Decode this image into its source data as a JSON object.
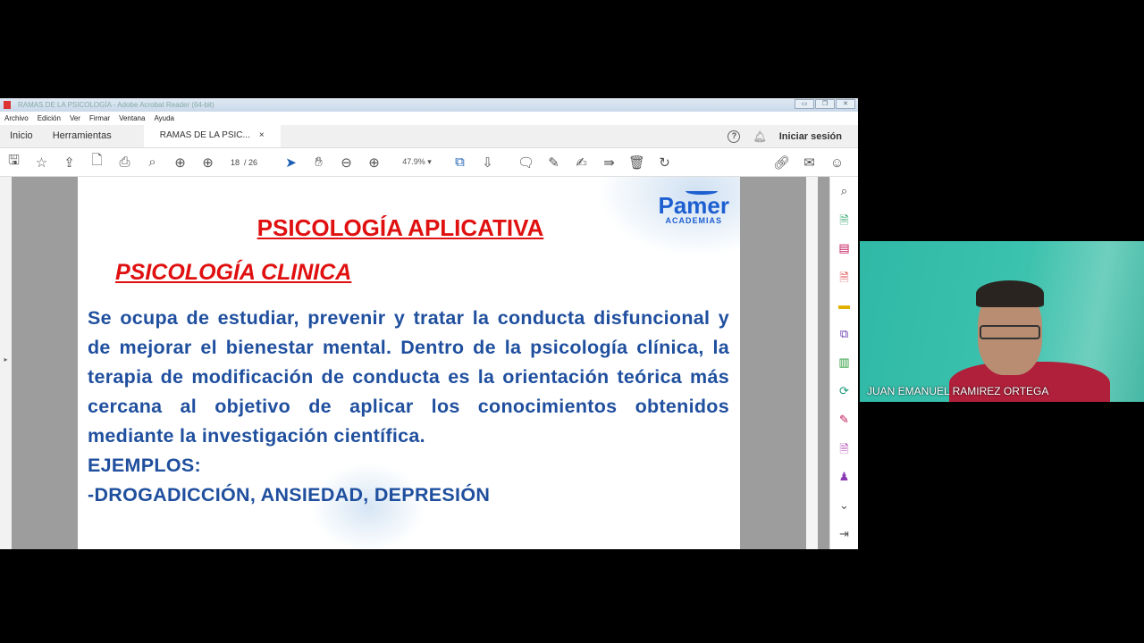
{
  "window": {
    "title": "RAMAS DE LA PSICOLOGÍA - Adobe Acrobat Reader (64-bit)",
    "controls": [
      "▭",
      "❐",
      "✕"
    ]
  },
  "menu": [
    "Archivo",
    "Edición",
    "Ver",
    "Firmar",
    "Ventana",
    "Ayuda"
  ],
  "tabs": {
    "home": "Inicio",
    "tools": "Herramientas",
    "doc": "RAMAS DE LA PSIC...",
    "close": "×",
    "help": "?",
    "signin": "Iniciar sesión"
  },
  "toolbar": {
    "page_current": "18",
    "page_total": "/ 26",
    "zoom": "47.9%"
  },
  "slide": {
    "logo_name": "Pamer",
    "logo_sub": "ACADEMIAS",
    "title": "PSICOLOGÍA APLICATIVA",
    "subtitle": "PSICOLOGÍA CLINICA",
    "paragraph": "Se ocupa de estudiar, prevenir y tratar la conducta disfuncional y de mejorar el bienestar mental. Dentro de la psicología clínica, la terapia de modificación de conducta es la orientación teórica más cercana al objetivo de aplicar los conocimientos obtenidos mediante la investigación científica.",
    "examples_label": "EJEMPLOS:",
    "examples": "-DROGADICCIÓN, ANSIEDAD, DEPRESIÓN"
  },
  "webcam": {
    "name": "JUAN EMANUEL RAMIREZ ORTEGA"
  }
}
